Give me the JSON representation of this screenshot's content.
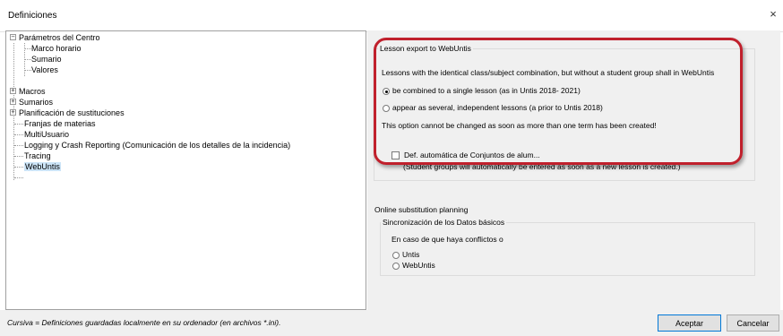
{
  "window": {
    "title": "Definiciones",
    "close_glyph": "×"
  },
  "tree": {
    "items": [
      {
        "label": "Parámetros del Centro",
        "expander": "−"
      },
      {
        "label": "Marco horario"
      },
      {
        "label": "Sumario"
      },
      {
        "label": "Valores"
      },
      {
        "label": "Macros",
        "expander": "+"
      },
      {
        "label": "Sumarios",
        "expander": "+"
      },
      {
        "label": "Planificación de sustituciones",
        "expander": "+"
      },
      {
        "label": "Franjas de materias"
      },
      {
        "label": "MultiUsuario"
      },
      {
        "label": "Logging y Crash Reporting (Comunicación de los detalles de la incidencia)"
      },
      {
        "label": "Tracing"
      },
      {
        "label": "WebUntis",
        "selected": true
      }
    ]
  },
  "lesson_export": {
    "group_title": "Lesson export to WebUntis",
    "description": "Lessons with the identical class/subject combination, but without a student group shall in WebUntis",
    "option_combined": "be combined to a single lesson (as in Untis 2018- 2021)",
    "option_several": "appear as several, independent lessons (a prior to Untis 2018)",
    "selected_option": "combined",
    "warning": "This option cannot be changed as soon as more than one term has been created!"
  },
  "student_groups": {
    "checkbox_label": "Def. automática de Conjuntos de alum...",
    "checked": false,
    "note": "(Student groups will automatically be entered as soon as a new lesson is created.)"
  },
  "online_sub": {
    "heading": "Online substitution planning",
    "group_title": "Sincronización de los Datos básicos",
    "conflict_label": "En caso de que haya conflictos o",
    "option_untis": "Untis",
    "option_webuntis": "WebUntis",
    "selected_option": null
  },
  "footer": {
    "note": "Cursiva = Definiciones guardadas localmente en su ordenador (en archivos *.ini).",
    "ok_label": "Aceptar",
    "cancel_label": "Cancelar"
  },
  "colors": {
    "highlight": "#c0202c",
    "selection": "#cce4f7",
    "panel_bg": "#f0f0f0"
  }
}
